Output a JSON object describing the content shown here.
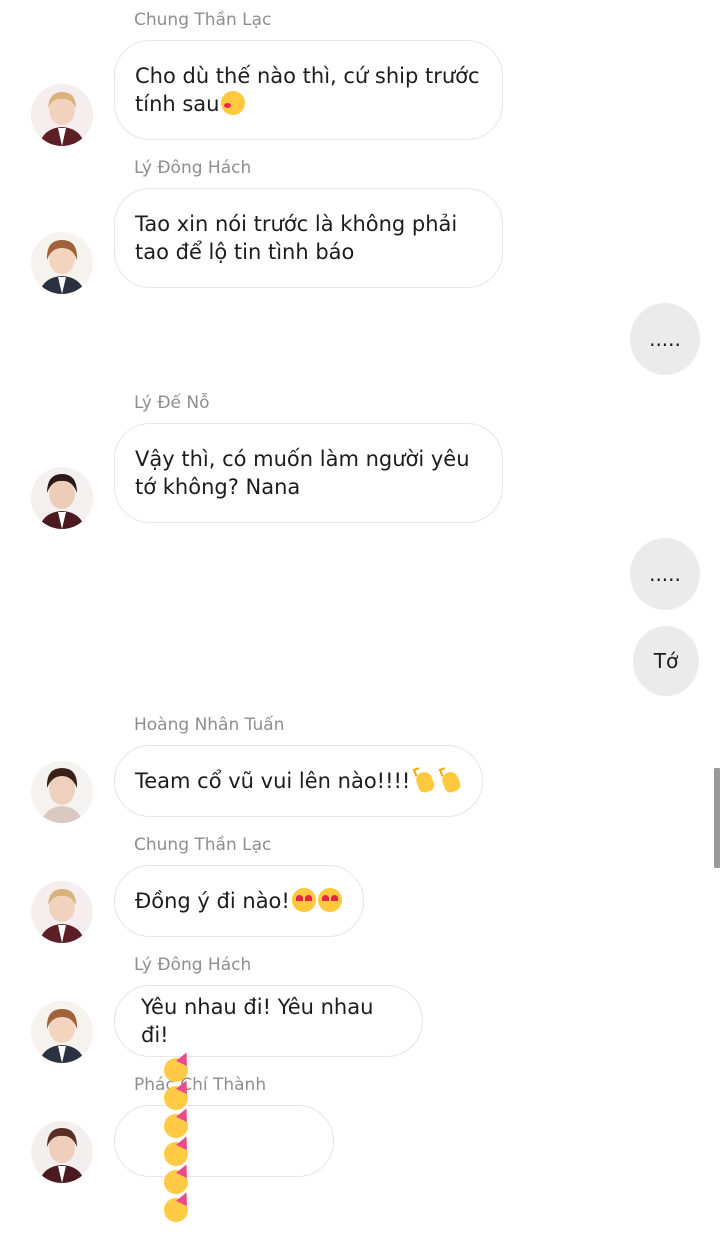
{
  "messages": [
    {
      "sender": "Chung Thần Lạc",
      "text": "Cho dù thế nào thì, cứ ship trước tính sau",
      "emoji": "smiling-face-with-hearts"
    },
    {
      "sender": "Lý Đông Hách",
      "text": "Tao xin nói trước là không phải tao để lộ tin tình báo"
    },
    {
      "self": true,
      "text": "....."
    },
    {
      "sender": "Lý Đế Nỗ",
      "text": "Vậy thì, có muốn làm người yêu tớ không? Nana"
    },
    {
      "self": true,
      "text": "....."
    },
    {
      "self": true,
      "text": "Tớ"
    },
    {
      "sender": "Hoàng Nhân Tuấn",
      "text": "Team cổ vũ vui lên nào!!!!",
      "emoji": "clapping-hands x2"
    },
    {
      "sender": "Chung Thần Lạc",
      "text": "Đồng ý đi nào!",
      "emoji": "heart-eyes x2"
    },
    {
      "sender": "Lý Đông Hách",
      "text": "Yêu nhau đi! Yêu nhau đi!"
    },
    {
      "sender": "Phác Chí Thành",
      "text": "",
      "emoji": "partying-face x6"
    }
  ]
}
